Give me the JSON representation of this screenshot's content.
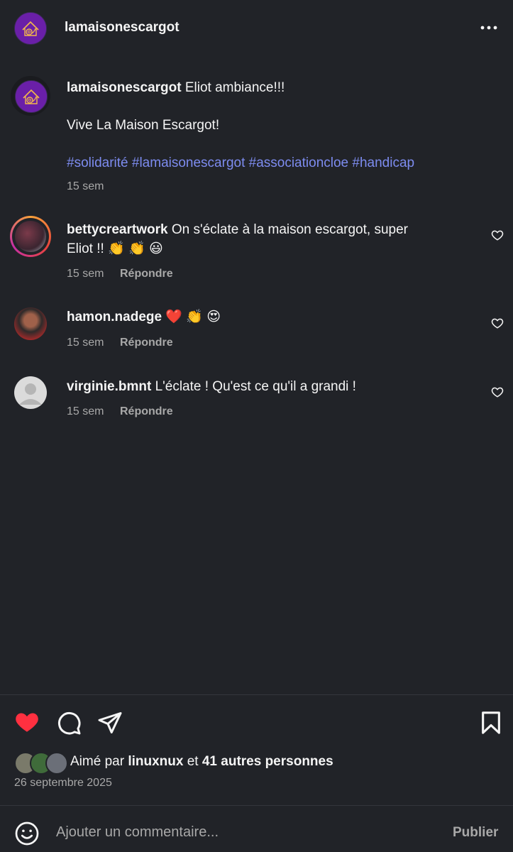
{
  "header": {
    "username": "lamaisonescargot",
    "more_icon": "more-horizontal-icon"
  },
  "post": {
    "username": "lamaisonescargot",
    "caption_line1": "Eliot ambiance!!!",
    "caption_line2": "Vive La Maison Escargot!",
    "hashtags": "#solidarité #lamaisonescargot #associationcloe #handicap",
    "time": "15 sem"
  },
  "comments": [
    {
      "username": "bettycreartwork",
      "text_line1": "On s'éclate à la maison escargot, super",
      "text_line2": "Eliot !! 👏 👏 😃",
      "time": "15 sem",
      "reply": "Répondre"
    },
    {
      "username": "hamon.nadege",
      "text": "❤️ 👏 😍",
      "time": "15 sem",
      "reply": "Répondre"
    },
    {
      "username": "virginie.bmnt",
      "text": "L'éclate ! Qu'est ce qu'il a grandi !",
      "time": "15 sem",
      "reply": "Répondre"
    }
  ],
  "actions": {
    "like_icon": "heart-filled-icon",
    "comment_icon": "comment-icon",
    "share_icon": "send-icon",
    "save_icon": "bookmark-icon",
    "like_color": "#ff3040"
  },
  "likes": {
    "prefix": "Aimé par",
    "user": "linuxnux",
    "conj": "et",
    "others": "41 autres personnes"
  },
  "date": "26 septembre 2025",
  "composer": {
    "emoji_icon": "emoji-icon",
    "placeholder": "Ajouter un commentaire...",
    "publish": "Publier"
  }
}
